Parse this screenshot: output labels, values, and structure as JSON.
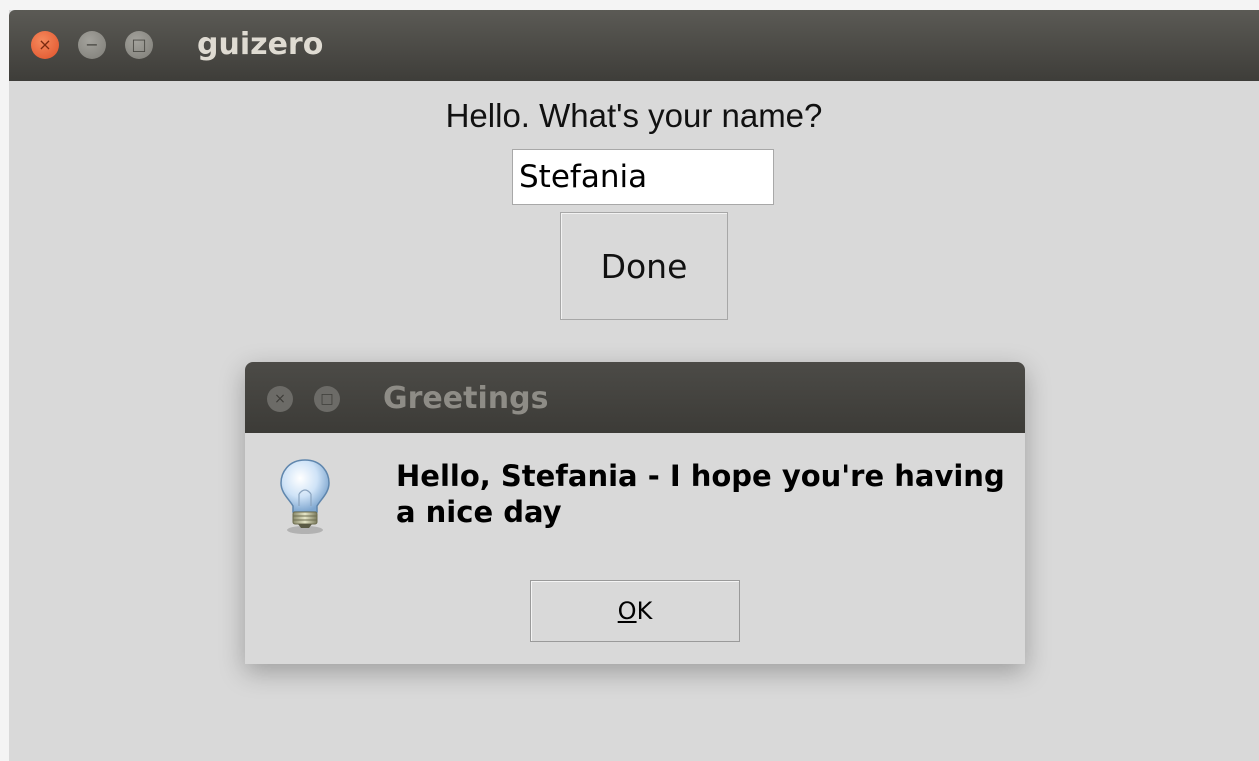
{
  "main_window": {
    "title": "guizero",
    "controls": {
      "close": "×",
      "minimize": "−",
      "maximize": "□"
    },
    "prompt": "Hello. What's your name?",
    "name_value": "Stefania",
    "done_label": "Done"
  },
  "dialog": {
    "title": "Greetings",
    "controls": {
      "close": "×",
      "maximize": "□"
    },
    "icon": "lightbulb-icon",
    "message": "Hello, Stefania - I hope you're having a nice day",
    "ok_label": {
      "mnemonic": "O",
      "rest": "K"
    }
  },
  "colors": {
    "titlebar": "#3e3d39",
    "close_button": "#e0512a",
    "window_bg": "#d9d9d9"
  }
}
